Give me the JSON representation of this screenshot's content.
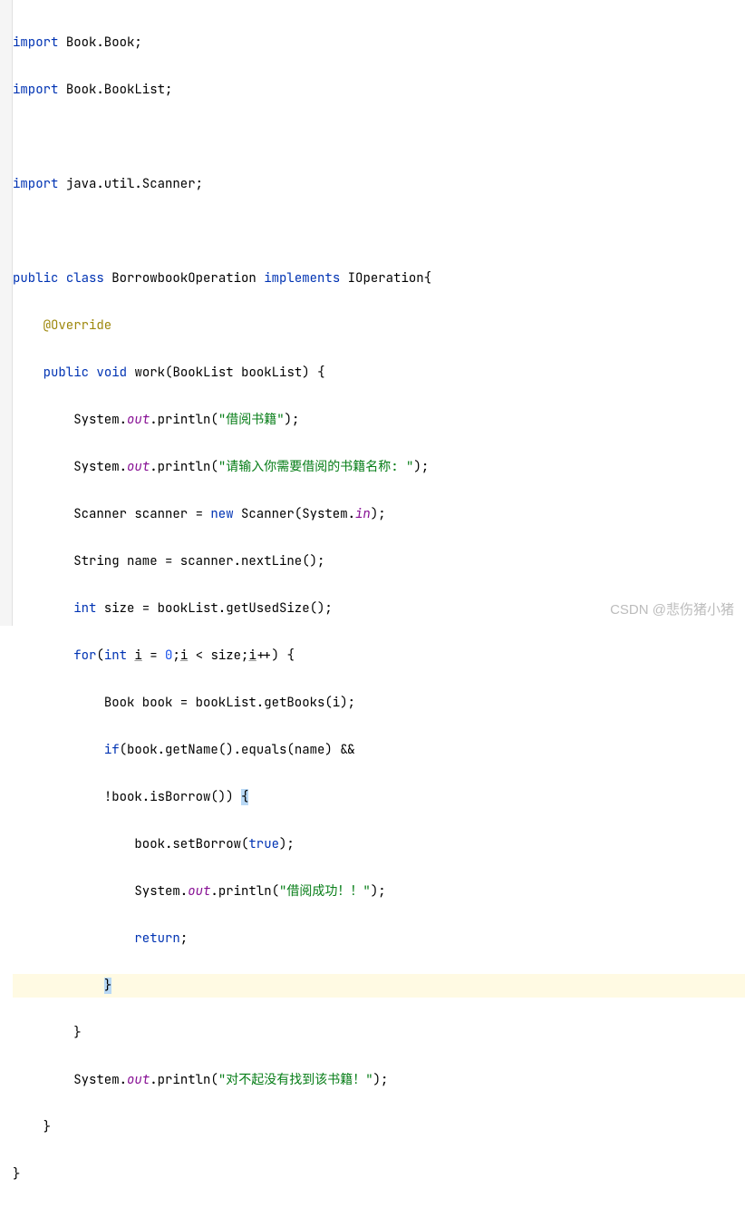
{
  "code": {
    "imports": [
      {
        "kw": "import",
        "pkg": "Book.Book",
        "end": ";"
      },
      {
        "kw": "import",
        "pkg": "Book.BookList",
        "end": ";"
      },
      {
        "blank": true
      },
      {
        "kw": "import",
        "pkg": "java.util.Scanner",
        "end": ";"
      }
    ],
    "classDecl": {
      "public": "public",
      "class": "class",
      "name": "BorrowbookOperation",
      "implements": "implements",
      "iface": "IOperation",
      "brace": "{"
    },
    "annotation": "@Override",
    "methodDecl": {
      "public": "public",
      "void": "void",
      "name": "work",
      "paramType": "BookList",
      "paramName": "bookList",
      "brace": " {"
    },
    "lines": {
      "l1a": "System.",
      "l1b": "out",
      "l1c": ".println(",
      "l1d": "\"借阅书籍\"",
      "l1e": ");",
      "l2a": "System.",
      "l2b": "out",
      "l2c": ".println(",
      "l2d": "\"请输入你需要借阅的书籍名称: \"",
      "l2e": ");",
      "l3a": "Scanner scanner = ",
      "l3b": "new",
      "l3c": " Scanner(System.",
      "l3d": "in",
      "l3e": ");",
      "l4": "String name = scanner.nextLine();",
      "l5a": "int",
      "l5b": " size = bookList.getUsedSize();",
      "l6a": "for",
      "l6b": "(",
      "l6c": "int",
      "l6d": " ",
      "l6e": "i",
      "l6f": " = ",
      "l6g": "0",
      "l6h": ";",
      "l6i": "i",
      "l6j": " < size;",
      "l6k": "i",
      "l6l": "++) {",
      "l7": "Book book = bookList.getBooks(i);",
      "l8a": "if",
      "l8b": "(book.getName().equals(name) &&",
      "l9a": "!book.isBorrow()) ",
      "l9b": "{",
      "l10a": "book.setBorrow(",
      "l10b": "true",
      "l10c": ");",
      "l11a": "System.",
      "l11b": "out",
      "l11c": ".println(",
      "l11d": "\"借阅成功！！\"",
      "l11e": ");",
      "l12a": "return",
      "l12b": ";",
      "l13": "}",
      "l14": "}",
      "l15a": "System.",
      "l15b": "out",
      "l15c": ".println(",
      "l15d": "\"对不起没有找到该书籍！\"",
      "l15e": ");",
      "l16": "}",
      "l17": "}"
    },
    "watermark": "CSDN @悲伤猪小猪"
  }
}
